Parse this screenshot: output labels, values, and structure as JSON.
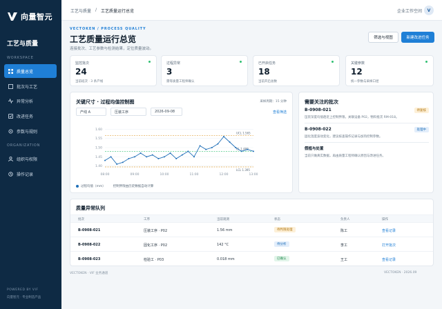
{
  "brand": {
    "logo_text": "向量智元",
    "section": "工艺与质量"
  },
  "sidebar": {
    "group1": "WORKSPACE",
    "group2": "ORGANIZATION",
    "items": [
      {
        "label": "质量总览",
        "icon": "grid-icon"
      },
      {
        "label": "批次与工艺",
        "icon": "layers-icon"
      },
      {
        "label": "异常分析",
        "icon": "pulse-icon"
      },
      {
        "label": "改进任务",
        "icon": "check-icon"
      },
      {
        "label": "参数与规则",
        "icon": "gear-icon"
      },
      {
        "label": "组织与权限",
        "icon": "users-icon"
      },
      {
        "label": "操作记录",
        "icon": "clock-icon"
      }
    ],
    "foot1": "POWERED BY VIF",
    "foot2": "向量智元 · 专业制造产品"
  },
  "topbar": {
    "crumb_root": "工艺与质量",
    "crumb_sep": "/",
    "crumb_current": "工艺质量运行总览",
    "workspace": "企业工作空间",
    "avatar": "V"
  },
  "page": {
    "eyebrow": "VECTOKEN / PROCESS QUALITY",
    "title": "工艺质量运行总览",
    "subtitle": "连接批次、工艺参数与检测结果，定位质量波动。",
    "btn_filter": "筛选与视图",
    "btn_new": "新建改进任务"
  },
  "kpis": [
    {
      "label": "监控批次",
      "value": "24",
      "note": "当前班次 · 3 条产线"
    },
    {
      "label": "过程异常",
      "value": "3",
      "note": "需等质量工程师确认"
    },
    {
      "label": "已开启任务",
      "value": "18",
      "note": "当前开启总数"
    },
    {
      "label": "关键参数",
      "value": "12",
      "note": "统一参数与采样口径"
    }
  ],
  "chart_card": {
    "title": "关键尺寸 · 过程均值控制图",
    "meta": "采样周期：15 分钟",
    "field_line": "产线 A",
    "field_process": "压装工序",
    "field_date": "2026-09-08",
    "link": "查看筛选",
    "legend_label": "过程均值（mm）",
    "legend_note": "控制界限由历史数据自动计算"
  },
  "chart_data": {
    "type": "line",
    "x_ticks": [
      "08:00",
      "09:00",
      "10:00",
      "11:00",
      "12:00",
      "13:00"
    ],
    "y_ticks": [
      "1.40",
      "1.45",
      "1.50",
      "1.55",
      "1.60"
    ],
    "ylim": [
      1.38,
      1.62
    ],
    "xlim": [
      0,
      25
    ],
    "series": [
      {
        "values": [
          1.43,
          1.45,
          1.41,
          1.42,
          1.44,
          1.45,
          1.47,
          1.45,
          1.46,
          1.44,
          1.45,
          1.47,
          1.44,
          1.46,
          1.48,
          1.45,
          1.51,
          1.49,
          1.5,
          1.52,
          1.56,
          1.53,
          1.5,
          1.48,
          1.49,
          1.48
        ],
        "color": "#1f6fb8"
      }
    ],
    "limits": [
      {
        "label": "UCL 1.565",
        "value": 1.565,
        "color": "#e0a23c"
      },
      {
        "label": "CL 1.480",
        "value": 1.48,
        "color": "#2fbf71"
      },
      {
        "label": "LCL 1.395",
        "value": 1.395,
        "color": "#e0a23c"
      }
    ]
  },
  "side_card": {
    "title": "需要关注的批次",
    "items": [
      {
        "id": "B-0908-021",
        "desc": "压装深度均值趋近上控制界限，关联设备 P02，物料批次 RM-018。",
        "badge": "待复核",
        "badge_bg": "#fdf0d8",
        "badge_fg": "#b07510"
      },
      {
        "id": "B-0908-022",
        "desc": "固化温度波动变化，建议核查操作记录与加热控制参数。",
        "badge": "处理中",
        "badge_bg": "#e3eefb",
        "badge_fg": "#1f6fb8"
      },
      {
        "id": "",
        "title": "假植与处置",
        "desc": "当前只做真实数据，再由质量工程师确认原因与改进任务。"
      }
    ]
  },
  "table": {
    "title": "质量异常队列",
    "headers": [
      "批次",
      "工序",
      "当前观测",
      "状态",
      "负责人",
      "操作"
    ],
    "rows": [
      {
        "batch": "B-0908-021",
        "process": "压装工序 · P02",
        "obs": "1.56 mm",
        "status": "待判限处理",
        "status_class": "st-warn",
        "owner": "陈工",
        "action": "查看记录"
      },
      {
        "batch": "B-0908-022",
        "process": "固化工序 · P02",
        "obs": "142 °C",
        "status": "待分析",
        "status_class": "st-blue",
        "owner": "李工",
        "action": "打开批次"
      },
      {
        "batch": "B-0908-023",
        "process": "检验工 · P03",
        "obs": "0.018 mm",
        "status": "已确认",
        "status_class": "st-green",
        "owner": "王工",
        "action": "查看记录"
      }
    ]
  },
  "footer": {
    "left": "VECTOKEN  ·  VIF 业务通道",
    "right": "VECTOKEN  ·  2026.09"
  }
}
